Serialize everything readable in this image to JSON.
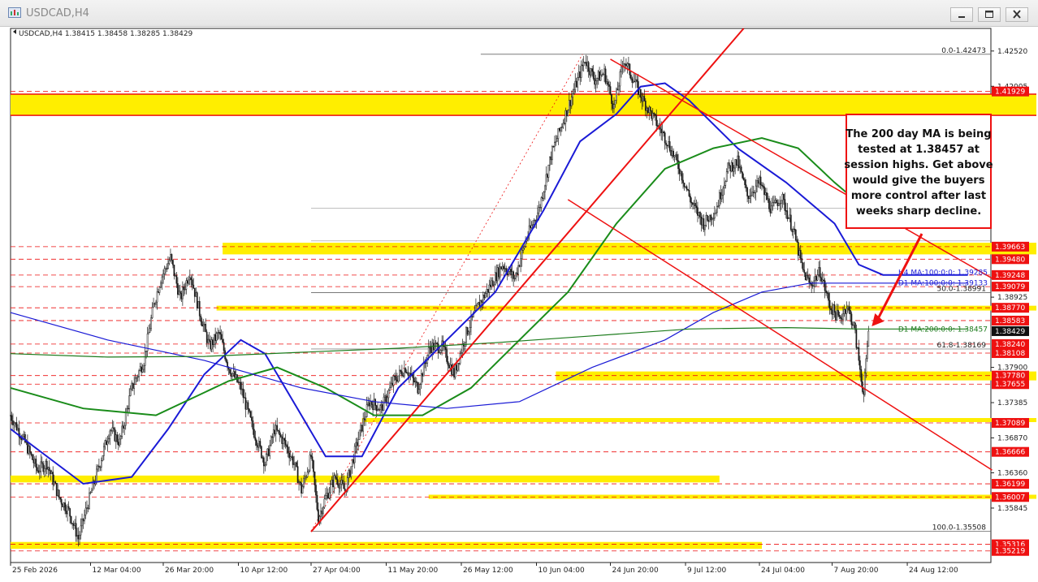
{
  "window": {
    "title": "USDCAD,H4",
    "minimize_icon": "minimize-icon",
    "maximize_icon": "restore-icon",
    "close_icon": "close-icon"
  },
  "chart_data": {
    "type": "candlestick",
    "symbol_info": "USDCAD,H4  1.38415 1.38458 1.38285 1.38429",
    "current_price": "1.38429",
    "ylim": [
      1.3505,
      1.4285
    ],
    "price_ticks": [
      {
        "v": 1.4252,
        "label": "1.42520"
      },
      {
        "v": 1.42005,
        "label": "1.42005"
      },
      {
        "v": 1.38925,
        "label": "1.38925"
      },
      {
        "v": 1.379,
        "label": "1.37900"
      },
      {
        "v": 1.37385,
        "label": "1.37385"
      },
      {
        "v": 1.3687,
        "label": "1.36870"
      },
      {
        "v": 1.3636,
        "label": "1.36360"
      },
      {
        "v": 1.35845,
        "label": "1.35845"
      }
    ],
    "level_labels": [
      {
        "v": 1.41929,
        "label": "1.41929"
      },
      {
        "v": 1.39663,
        "label": "1.39663"
      },
      {
        "v": 1.3948,
        "label": "1.39480"
      },
      {
        "v": 1.39248,
        "label": "1.39248"
      },
      {
        "v": 1.39079,
        "label": "1.39079"
      },
      {
        "v": 1.3877,
        "label": "1.38770"
      },
      {
        "v": 1.38583,
        "label": "1.38583"
      },
      {
        "v": 1.3824,
        "label": "1.38240"
      },
      {
        "v": 1.38108,
        "label": "1.38108"
      },
      {
        "v": 1.3778,
        "label": "1.37780"
      },
      {
        "v": 1.37655,
        "label": "1.37655"
      },
      {
        "v": 1.37089,
        "label": "1.37089"
      },
      {
        "v": 1.36666,
        "label": "1.36666"
      },
      {
        "v": 1.36199,
        "label": "1.36199"
      },
      {
        "v": 1.36007,
        "label": "1.36007"
      },
      {
        "v": 1.35316,
        "label": "1.35316"
      },
      {
        "v": 1.35219,
        "label": "1.35219"
      }
    ],
    "x_ticks": [
      {
        "i": 0,
        "label": "25 Feb 2026"
      },
      {
        "i": 66,
        "label": "12 Mar 04:00"
      },
      {
        "i": 126,
        "label": "26 Mar 20:00"
      },
      {
        "i": 188,
        "label": "10 Apr 12:00"
      },
      {
        "i": 248,
        "label": "27 Apr 04:00"
      },
      {
        "i": 310,
        "label": "11 May 20:00"
      },
      {
        "i": 372,
        "label": "26 May 12:00"
      },
      {
        "i": 434,
        "label": "10 Jun 04:00"
      },
      {
        "i": 495,
        "label": "24 Jun 20:00"
      },
      {
        "i": 557,
        "label": "9 Jul 12:00"
      },
      {
        "i": 618,
        "label": "24 Jul 04:00"
      },
      {
        "i": 678,
        "label": "7 Aug 20:00"
      },
      {
        "i": 740,
        "label": "24 Aug 12:00"
      }
    ],
    "bar_count": 810,
    "last_bar_index": 708,
    "price_path": [
      [
        0,
        1.372
      ],
      [
        12,
        1.368
      ],
      [
        22,
        1.364
      ],
      [
        30,
        1.365
      ],
      [
        40,
        1.36
      ],
      [
        48,
        1.358
      ],
      [
        56,
        1.354
      ],
      [
        62,
        1.358
      ],
      [
        72,
        1.364
      ],
      [
        82,
        1.37
      ],
      [
        90,
        1.368
      ],
      [
        100,
        1.376
      ],
      [
        110,
        1.38
      ],
      [
        118,
        1.388
      ],
      [
        124,
        1.392
      ],
      [
        132,
        1.395
      ],
      [
        140,
        1.389
      ],
      [
        148,
        1.393
      ],
      [
        156,
        1.387
      ],
      [
        164,
        1.382
      ],
      [
        172,
        1.384
      ],
      [
        180,
        1.379
      ],
      [
        190,
        1.376
      ],
      [
        200,
        1.37
      ],
      [
        210,
        1.365
      ],
      [
        218,
        1.37
      ],
      [
        226,
        1.368
      ],
      [
        234,
        1.365
      ],
      [
        240,
        1.361
      ],
      [
        248,
        1.366
      ],
      [
        254,
        1.357
      ],
      [
        260,
        1.36
      ],
      [
        268,
        1.363
      ],
      [
        276,
        1.361
      ],
      [
        286,
        1.368
      ],
      [
        296,
        1.374
      ],
      [
        306,
        1.373
      ],
      [
        316,
        1.377
      ],
      [
        326,
        1.379
      ],
      [
        336,
        1.376
      ],
      [
        346,
        1.382
      ],
      [
        356,
        1.382
      ],
      [
        366,
        1.378
      ],
      [
        376,
        1.384
      ],
      [
        386,
        1.388
      ],
      [
        396,
        1.391
      ],
      [
        406,
        1.394
      ],
      [
        416,
        1.392
      ],
      [
        426,
        1.398
      ],
      [
        436,
        1.402
      ],
      [
        446,
        1.41
      ],
      [
        456,
        1.415
      ],
      [
        466,
        1.42
      ],
      [
        474,
        1.424
      ],
      [
        482,
        1.421
      ],
      [
        490,
        1.422
      ],
      [
        498,
        1.417
      ],
      [
        506,
        1.424
      ],
      [
        514,
        1.421
      ],
      [
        522,
        1.418
      ],
      [
        532,
        1.415
      ],
      [
        542,
        1.412
      ],
      [
        552,
        1.408
      ],
      [
        562,
        1.403
      ],
      [
        572,
        1.4
      ],
      [
        582,
        1.402
      ],
      [
        592,
        1.408
      ],
      [
        600,
        1.409
      ],
      [
        608,
        1.404
      ],
      [
        618,
        1.406
      ],
      [
        628,
        1.402
      ],
      [
        636,
        1.404
      ],
      [
        646,
        1.399
      ],
      [
        654,
        1.393
      ],
      [
        660,
        1.391
      ],
      [
        668,
        1.393
      ],
      [
        676,
        1.388
      ],
      [
        684,
        1.386
      ],
      [
        690,
        1.388
      ],
      [
        696,
        1.385
      ],
      [
        700,
        1.38
      ],
      [
        704,
        1.375
      ],
      [
        708,
        1.3843
      ]
    ],
    "annotation": "The 200 day MA is being tested at 1.38457 at session highs. Get above would give the buyers more control after last weeks sharp decline.",
    "fib_labels": [
      {
        "v": 1.42473,
        "label": "0.0-1.42473"
      },
      {
        "v": 1.38991,
        "label": "50.0-1.38991"
      },
      {
        "v": 1.38169,
        "label": "61.8-1.38169"
      },
      {
        "v": 1.35508,
        "label": "100.0-1.35508"
      }
    ],
    "ma_labels": [
      {
        "v": 1.39285,
        "label": "H4 MA:100:0:0: 1.39285",
        "color": "#1a1ad6"
      },
      {
        "v": 1.39133,
        "label": "D1 MA:100:0:0: 1.39133",
        "color": "#1a1ad6"
      },
      {
        "v": 1.38457,
        "label": "D1 MA:200:0:0: 1.38457",
        "color": "#1a7a1a"
      }
    ],
    "colors": {
      "candle": "#1a1a1a",
      "h4_ma100": "#1a1ad6",
      "d1_ma100": "#1a1ad6",
      "d1_ma200": "#1a7a1a",
      "h4_ma200": "#1a8c1a",
      "trendline": "#ee1111",
      "zone": "#ffee00",
      "dash_level": "#ee1111",
      "price_tag": "#ee1111",
      "current_tag": "#111111",
      "annotation_border": "#ee1111"
    }
  }
}
